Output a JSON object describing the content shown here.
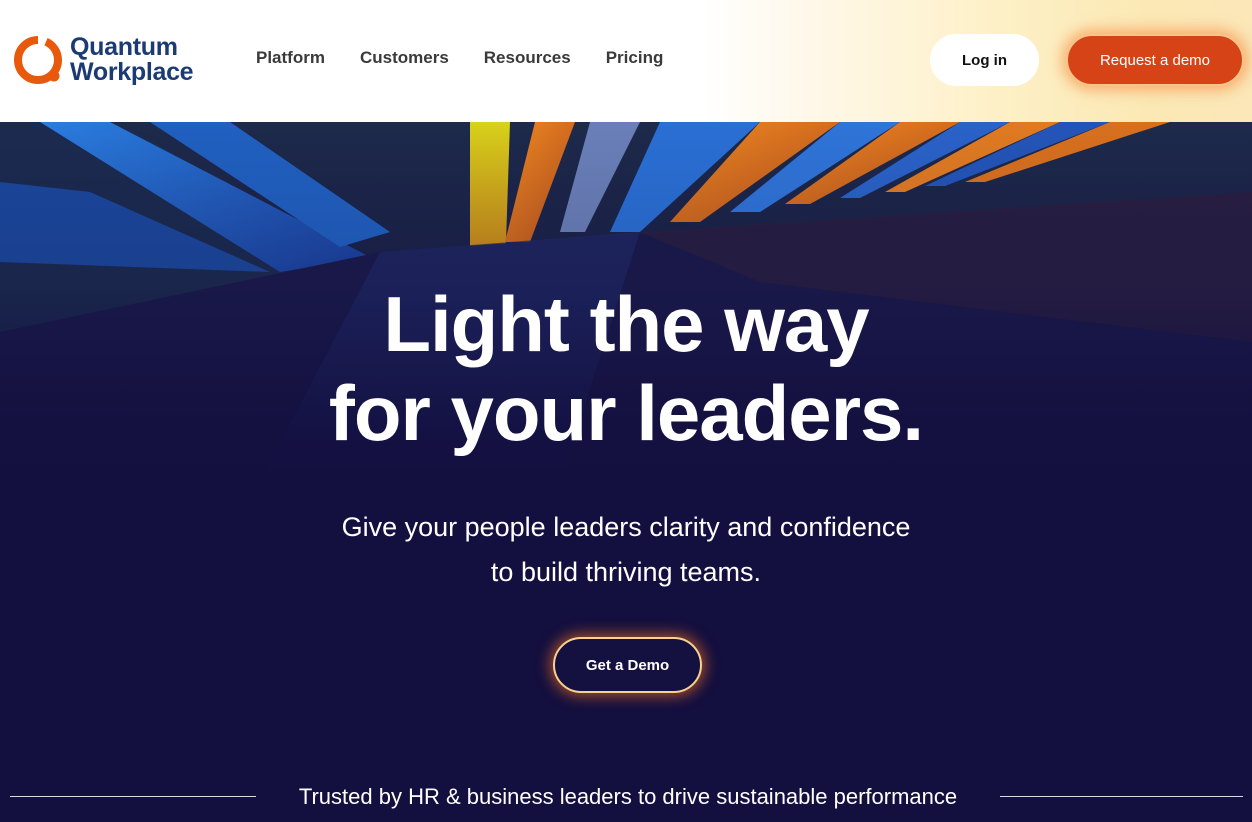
{
  "brand": {
    "name_line1": "Quantum",
    "name_line2": "Workplace",
    "logo_icon": "quantum-ring-icon",
    "colors": {
      "orange": "#e8590c",
      "navy": "#1c3b73"
    }
  },
  "nav": {
    "items": [
      {
        "label": "Platform"
      },
      {
        "label": "Customers"
      },
      {
        "label": "Resources"
      },
      {
        "label": "Pricing"
      }
    ]
  },
  "header_actions": {
    "login_label": "Log in",
    "request_demo_label": "Request a demo"
  },
  "hero": {
    "headline_line1": "Light the way",
    "headline_line2": "for your leaders.",
    "subhead_line1": "Give your people leaders clarity and confidence",
    "subhead_line2": "to build thriving teams.",
    "cta_label": "Get a Demo",
    "trusted_text": "Trusted by HR & business leaders to drive sustainable performance",
    "background_color": "#130f3f",
    "accent_glow": "#f46e1e"
  }
}
